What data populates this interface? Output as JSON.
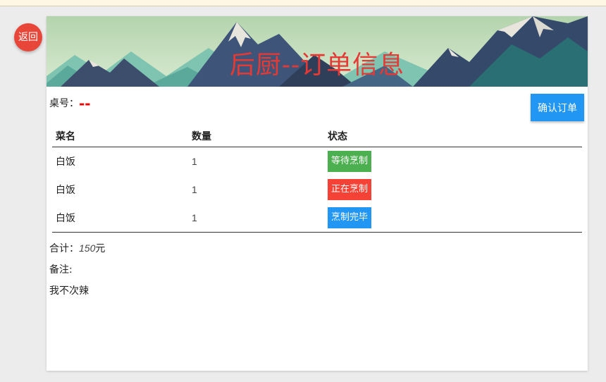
{
  "back_button": {
    "label": "返回"
  },
  "banner": {
    "title": "后厨--订单信息"
  },
  "order": {
    "table_label": "桌号：",
    "table_value": "--",
    "confirm_label": "确认订单"
  },
  "columns": {
    "dish": "菜名",
    "qty": "数量",
    "status": "状态"
  },
  "items": [
    {
      "dish": "白饭",
      "qty": "1",
      "status": "等待烹制",
      "status_color": "#4caf50"
    },
    {
      "dish": "白饭",
      "qty": "1",
      "status": "正在烹制",
      "status_color": "#f44336"
    },
    {
      "dish": "白饭",
      "qty": "1",
      "status": "烹制完毕",
      "status_color": "#2196f3"
    }
  ],
  "summary": {
    "total_label": "合计：",
    "total_value": "150",
    "total_unit": "元",
    "note_label": "备注:",
    "note_value": "我不次辣"
  },
  "colors": {
    "accent": "#2196f3",
    "danger": "#e53935",
    "success": "#4caf50"
  }
}
